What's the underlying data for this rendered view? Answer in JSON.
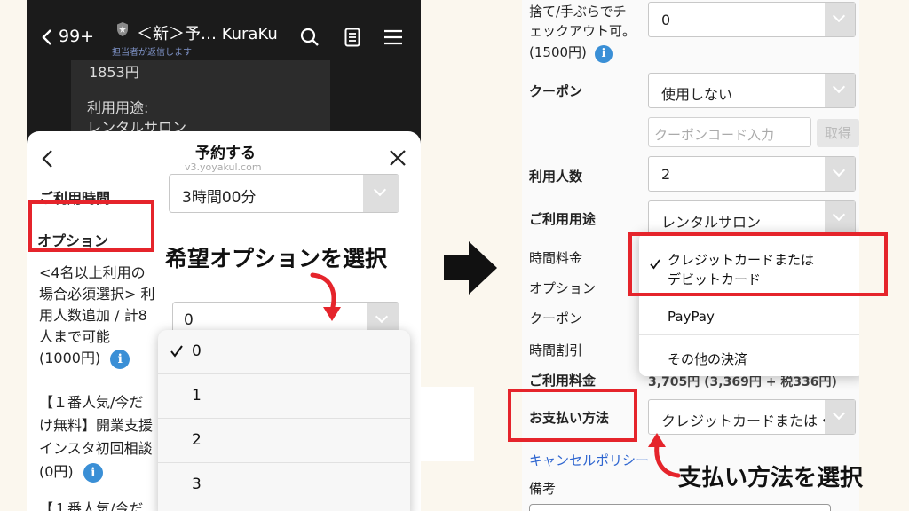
{
  "left": {
    "header": {
      "back_count": "99+",
      "title": "＜新＞予… KuraKu",
      "subtitle": "担当者が返信します"
    },
    "bubble": {
      "price": "1853円",
      "usage_label": "利用用途:",
      "usage_value": "レンタルサロン"
    },
    "sheet": {
      "title": "予約する",
      "url": "v3.yoyakul.com",
      "time_label": "ご利用時間",
      "time_value": "3時間00分",
      "options_heading": "オプション",
      "option1_lines": [
        "<4名以上利用の",
        "場合必須選択> 利",
        "用人数追加 / 計8",
        "人まで可能"
      ],
      "option1_price": "(1000円)",
      "option1_value": "0",
      "option2_lines": [
        "【１番人気/今だ",
        "け無料】開業支援",
        "インスタ初回相談"
      ],
      "option2_price": "(0円)",
      "option3_line": "【１番人気/今だ",
      "dropdown": [
        "0",
        "1",
        "2",
        "3"
      ],
      "dropdown_selected": "0",
      "info_glyph": "i"
    },
    "annotation": "希望オプションを選択",
    "icons": {
      "back": "chevron-left-icon",
      "search": "search-icon",
      "menu": "hamburger-icon",
      "notes": "note-icon",
      "close": "close-icon",
      "check": "check-icon"
    }
  },
  "right": {
    "row0_lines": [
      "捨て/手ぶらでチ",
      "ェックアウト可。",
      "(1500円)"
    ],
    "row0_value": "0",
    "coupon_label": "クーポン",
    "coupon_value": "使用しない",
    "coupon_placeholder": "クーポンコード入力",
    "coupon_apply": "取得",
    "people_label": "利用人数",
    "people_value": "2",
    "usage_label": "ご利用用途",
    "usage_value": "レンタルサロン",
    "summary": [
      "時間料金",
      "オプション",
      "クーポン",
      "時間割引"
    ],
    "total_label": "ご利用料金",
    "total_value": "3,705円 (3,369円 + 税336円)",
    "payment_label": "お支払い方法",
    "payment_value": "クレジットカードまたは・",
    "popup": {
      "selected_line1": "クレジットカードまたは",
      "selected_line2": "デビットカード",
      "paypay": "PayPay",
      "other": "その他の決済"
    },
    "cancel_link": "キャンセルポリシー",
    "notes_label": "備考",
    "annotation": "支払い方法を選択"
  },
  "colors": {
    "highlight": "#e5242b",
    "link": "#2f66d0",
    "info": "#3a8fd6"
  }
}
